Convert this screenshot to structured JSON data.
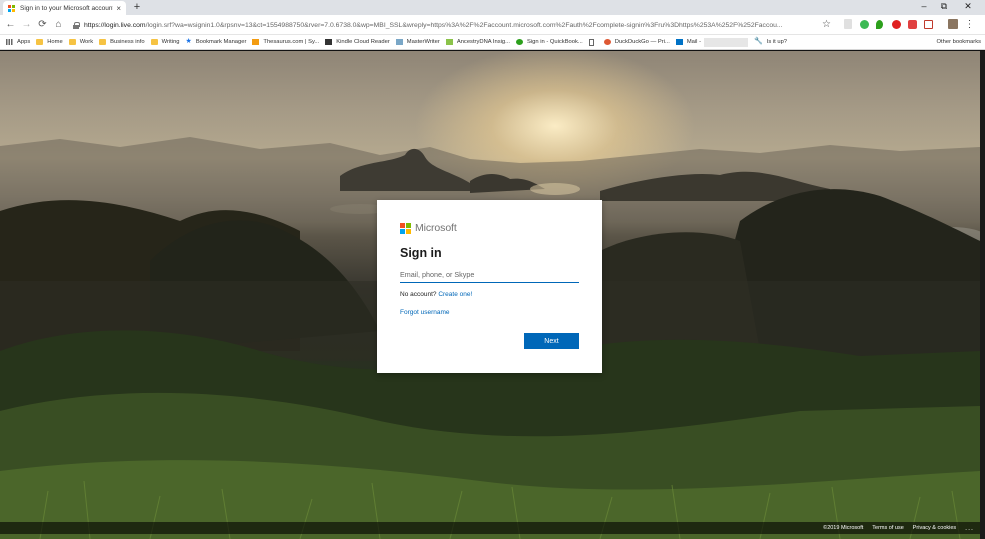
{
  "browser": {
    "tab": {
      "title": "Sign in to your Microsoft account",
      "close": "×"
    },
    "new_tab": "+",
    "window_controls": {
      "minimize": "–",
      "restore": "⧉",
      "close": "✕"
    },
    "nav": {
      "back": "←",
      "forward": "→",
      "reload": "⟳",
      "home": "⌂"
    },
    "url": {
      "host": "https://login.live.com",
      "path": "/login.srf?wa=wsignin1.0&rpsnv=13&ct=1554988750&rver=7.0.6738.0&wp=MBI_SSL&wreply=https%3A%2F%2Faccount.microsoft.com%2Fauth%2Fcomplete-signin%3Fru%3Dhttps%253A%252F%252Faccou..."
    },
    "star": "☆",
    "menu": "⋮",
    "bookmarks": [
      {
        "label": "Apps",
        "icon": "apps-grid-icon"
      },
      {
        "label": "Home",
        "icon": "folder-icon"
      },
      {
        "label": "Work",
        "icon": "folder-icon"
      },
      {
        "label": "Business info",
        "icon": "folder-icon"
      },
      {
        "label": "Writing",
        "icon": "folder-icon"
      },
      {
        "label": "Bookmark Manager",
        "icon": "star-icon"
      },
      {
        "label": "Thesaurus.com | Sy...",
        "icon": "thesaurus-icon"
      },
      {
        "label": "Kindle Cloud Reader",
        "icon": "kindle-icon"
      },
      {
        "label": "MasterWriter",
        "icon": "masterwriter-icon"
      },
      {
        "label": "AncestryDNA Insig...",
        "icon": "ancestry-icon"
      },
      {
        "label": "Sign in - QuickBook...",
        "icon": "quickbooks-icon"
      },
      {
        "label": "",
        "icon": "page-icon"
      },
      {
        "label": "DuckDuckGo — Pri...",
        "icon": "duckduckgo-icon"
      },
      {
        "label": "Mail -",
        "icon": "outlook-icon"
      },
      {
        "label": "Is it up?",
        "icon": "wrench-icon"
      }
    ],
    "other_bookmarks": "Other bookmarks",
    "colors": {
      "folder": "#f6c343",
      "star": "#1a73e8",
      "quickbooks": "#2ca01c",
      "duckduckgo": "#de5833",
      "outlook": "#0072c6"
    }
  },
  "login": {
    "brand": "Microsoft",
    "logo_colors": [
      "#f25022",
      "#7fba00",
      "#00a4ef",
      "#ffb900"
    ],
    "heading": "Sign in",
    "email_placeholder": "Email, phone, or Skype",
    "email_value": "",
    "no_account_text": "No account?",
    "create_link": "Create one!",
    "forgot_link": "Forgot username",
    "next_button": "Next",
    "accent": "#0067b8"
  },
  "footer": {
    "copyright": "©2019 Microsoft",
    "terms": "Terms of use",
    "privacy": "Privacy & cookies",
    "more": "..."
  }
}
